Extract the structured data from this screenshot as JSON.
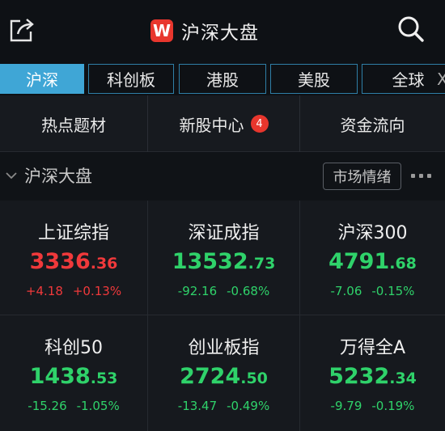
{
  "header": {
    "logo_letter": "W",
    "title": "沪深大盘"
  },
  "tabs": [
    {
      "label": "沪深",
      "active": true
    },
    {
      "label": "科创板",
      "active": false
    },
    {
      "label": "港股",
      "active": false
    },
    {
      "label": "美股",
      "active": false
    },
    {
      "label": "全球",
      "active": false
    }
  ],
  "tabs_more": "X",
  "subnav": [
    {
      "label": "热点题材"
    },
    {
      "label": "新股中心",
      "badge": "4"
    },
    {
      "label": "资金流向"
    }
  ],
  "section": {
    "title": "沪深大盘",
    "mood_button": "市场情绪"
  },
  "indices": [
    {
      "name": "上证综指",
      "int": "3336",
      "dec": ".36",
      "change": "+4.18",
      "pct": "+0.13%",
      "direction": "up"
    },
    {
      "name": "深证成指",
      "int": "13532",
      "dec": ".73",
      "change": "-92.16",
      "pct": "-0.68%",
      "direction": "down"
    },
    {
      "name": "沪深300",
      "int": "4791",
      "dec": ".68",
      "change": "-7.06",
      "pct": "-0.15%",
      "direction": "down"
    },
    {
      "name": "科创50",
      "int": "1438",
      "dec": ".53",
      "change": "-15.26",
      "pct": "-1.05%",
      "direction": "down"
    },
    {
      "name": "创业板指",
      "int": "2724",
      "dec": ".50",
      "change": "-13.47",
      "pct": "-0.49%",
      "direction": "down"
    },
    {
      "name": "万得全A",
      "int": "5232",
      "dec": ".34",
      "change": "-9.79",
      "pct": "-0.19%",
      "direction": "down"
    }
  ],
  "colors": {
    "up": "#f0393b",
    "down": "#2fd26a",
    "accent": "#3fa6d6",
    "badge": "#e8362d"
  }
}
